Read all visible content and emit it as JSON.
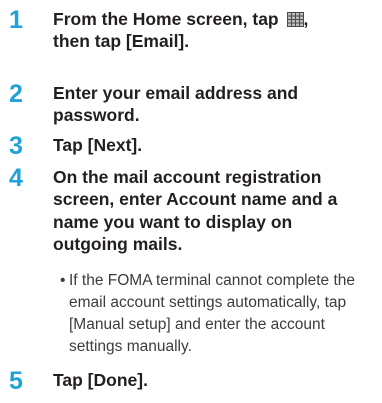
{
  "steps": [
    {
      "number": "1",
      "text_before_icon": "From the Home screen, tap",
      "icon": "app-grid-icon",
      "text_after_icon": ",",
      "text_line2": "then tap [Email]."
    },
    {
      "number": "2",
      "text": "Enter your email address and password."
    },
    {
      "number": "3",
      "text": "Tap [Next]."
    },
    {
      "number": "4",
      "text": "On the mail account registration screen, enter Account name and a name you want to display on outgoing mails.",
      "note_bullet": "•",
      "note": "If the FOMA terminal cannot complete the email account settings automatically, tap [Manual setup] and enter the account settings manually."
    },
    {
      "number": "5",
      "text": "Tap [Done]."
    }
  ],
  "colors": {
    "step_number": "#1fa2d8",
    "text": "#231f20",
    "note_text": "#3c3c3c"
  }
}
